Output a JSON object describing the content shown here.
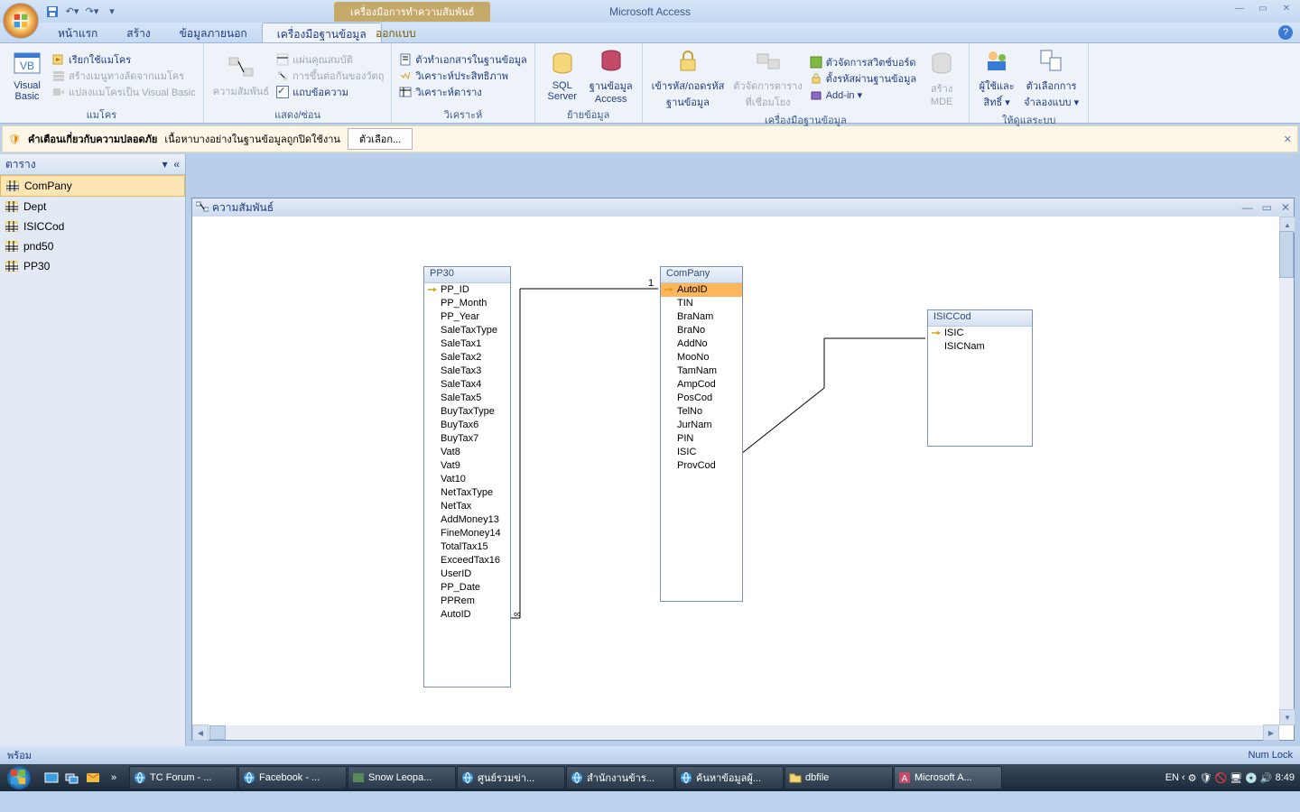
{
  "title": "Microsoft Access",
  "context_tab": "เครื่องมือการทำความสัมพันธ์",
  "tabs": [
    "หน้าแรก",
    "สร้าง",
    "ข้อมูลภายนอก",
    "เครื่องมือฐานข้อมูล",
    "ออกแบบ"
  ],
  "tabs_sel": 3,
  "ribbon": {
    "g0": {
      "label": "แมโคร",
      "vb": "Visual\nBasic",
      "i0": "เรียกใช้แมโคร",
      "i1": "สร้างเมนูทางลัดจากแมโคร",
      "i2": "แปลงแมโครเป็น Visual Basic"
    },
    "g1": {
      "label": "แสดง/ซ่อน",
      "rel": "ความสัมพันธ์",
      "i0": "แผ่นคุณสมบัติ",
      "i1": "การขึ้นต่อกันของวัตถุ",
      "i2": "แถบข้อความ"
    },
    "g2": {
      "label": "วิเคราะห์",
      "i0": "ตัวทำเอกสารในฐานข้อมูล",
      "i1": "วิเคราะห์ประสิทธิภาพ",
      "i2": "วิเคราะห์ตาราง"
    },
    "g3": {
      "label": "ย้ายข้อมูล",
      "sql": "SQL\nServer",
      "acc": "ฐานข้อมูล\nAccess"
    },
    "g4": {
      "label": "เครื่องมือฐานข้อมูล",
      "enc": "เข้ารหัส/ถอดรหัส\nฐานข้อมูล",
      "link": "ตัวจัดการตาราง\nที่เชื่อมโยง",
      "i0": "ตัวจัดการสวิตช์บอร์ด",
      "i1": "ตั้งรหัสผ่านฐานข้อมูล",
      "i2": "Add-in ▾",
      "mde": "สร้าง\nMDE"
    },
    "g5": {
      "label": "ให้ดูแลระบบ",
      "perm": "ผู้ใช้และ\nสิทธิ์ ▾",
      "rep": "ตัวเลือกการ\nจำลองแบบ ▾"
    }
  },
  "msgbar": {
    "title": "คำเตือนเกี่ยวกับความปลอดภัย",
    "body": "เนื้อหาบางอย่างในฐานข้อมูลถูกปิดใช้งาน",
    "btn": "ตัวเลือก..."
  },
  "nav": {
    "title": "ตาราง",
    "items": [
      "ComPany",
      "Dept",
      "ISICCod",
      "pnd50",
      "PP30"
    ],
    "sel": 0
  },
  "relwin": {
    "title": "ความสัมพันธ์"
  },
  "tables": {
    "pp30": {
      "title": "PP30",
      "fields": [
        "PP_ID",
        "PP_Month",
        "PP_Year",
        "SaleTaxType",
        "SaleTax1",
        "SaleTax2",
        "SaleTax3",
        "SaleTax4",
        "SaleTax5",
        "BuyTaxType",
        "BuyTax6",
        "BuyTax7",
        "Vat8",
        "Vat9",
        "Vat10",
        "NetTaxType",
        "NetTax",
        "AddMoney13",
        "FineMoney14",
        "TotalTax15",
        "ExceedTax16",
        "UserID",
        "PP_Date",
        "PPRem",
        "AutoID"
      ],
      "pk": 0
    },
    "company": {
      "title": "ComPany",
      "fields": [
        "AutoID",
        "TIN",
        "BraNam",
        "BraNo",
        "AddNo",
        "MooNo",
        "TamNam",
        "AmpCod",
        "PosCod",
        "TelNo",
        "JurNam",
        "PIN",
        "ISIC",
        "ProvCod"
      ],
      "pk": 0,
      "sel": 0
    },
    "isic": {
      "title": "ISICCod",
      "fields": [
        "ISIC",
        "ISICNam"
      ],
      "pk": 0
    }
  },
  "rel_labels": {
    "one": "1",
    "many": "∞"
  },
  "status": {
    "left": "พร้อม",
    "right": "Num Lock"
  },
  "taskbar": {
    "items": [
      {
        "label": "TC Forum - ...",
        "icon": "ie"
      },
      {
        "label": "Facebook - ...",
        "icon": "ie"
      },
      {
        "label": "Snow Leopa...",
        "icon": "img"
      },
      {
        "label": "ศูนย์รวมข่า...",
        "icon": "ie"
      },
      {
        "label": "สำนักงานข้าร...",
        "icon": "ie"
      },
      {
        "label": "ค้นหาข้อมูลผู้...",
        "icon": "ie"
      },
      {
        "label": "dbfile",
        "icon": "folder"
      },
      {
        "label": "Microsoft A...",
        "icon": "access",
        "active": true
      }
    ],
    "lang": "EN",
    "time": "8:49"
  }
}
